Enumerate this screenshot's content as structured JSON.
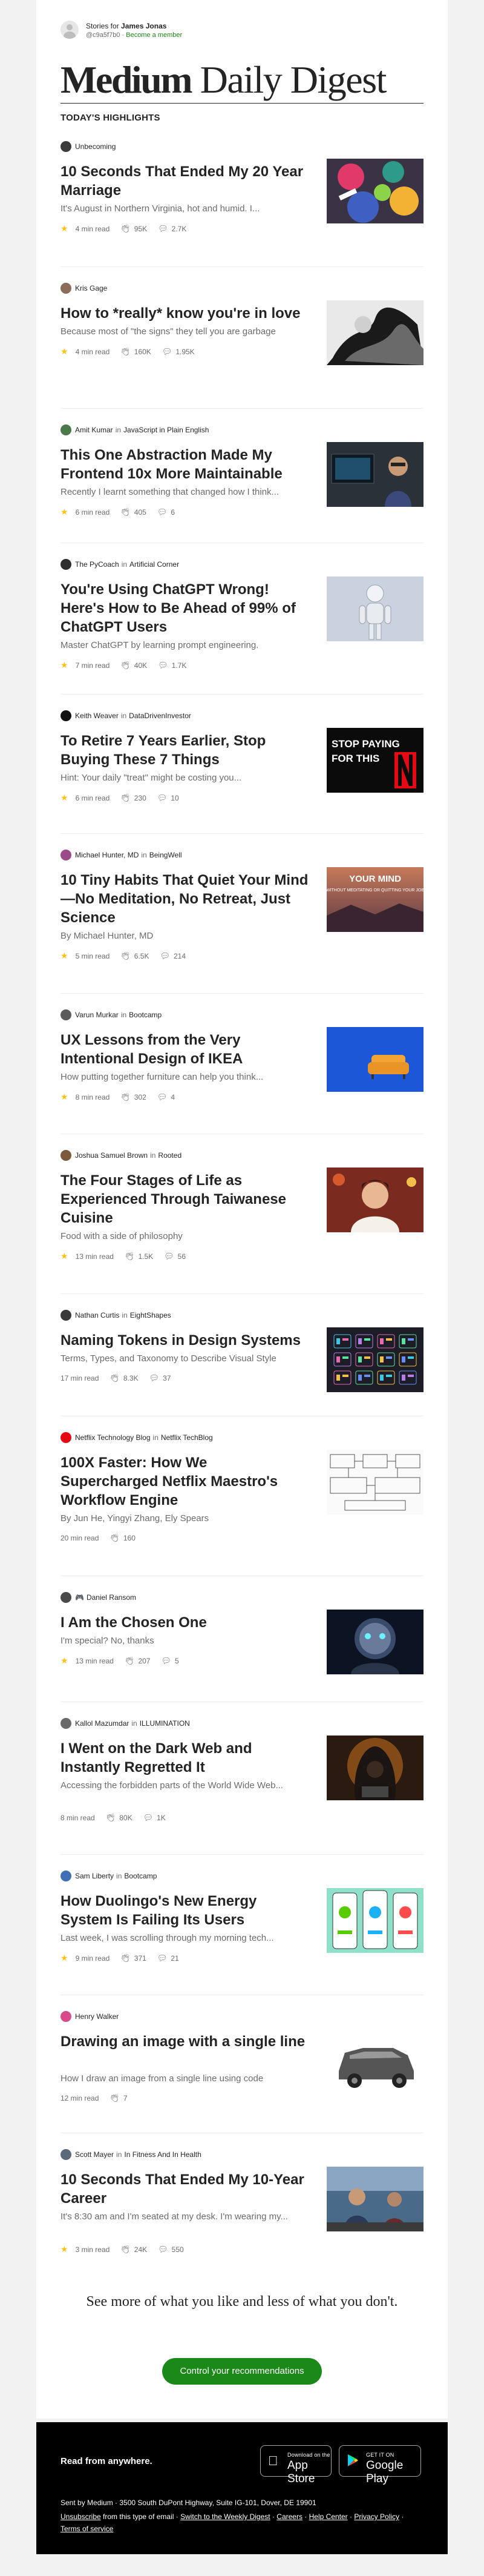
{
  "header": {
    "stories_for_prefix": "Stories for",
    "user_name": "James Jonas",
    "handle": "@c9a5f7b0",
    "separator": "·",
    "become_member": "Become a member"
  },
  "masthead": {
    "brand": "Medium",
    "subtitle": "Daily Digest"
  },
  "section_title": "TODAY'S HIGHLIGHTS",
  "stories": [
    {
      "author": "Unbecoming",
      "in": "",
      "publication": "",
      "title": "10 Seconds That Ended My 20 Year Marriage",
      "subtitle": "It's August in Northern Virginia, hot and humid. I...",
      "member": true,
      "read_time": "4 min read",
      "claps": "95K",
      "responses": "2.7K",
      "icon_color": "#3c3c3c",
      "thumb": "paint"
    },
    {
      "author": "Kris Gage",
      "in": "",
      "publication": "",
      "title": "How to *really* know you're in love",
      "subtitle": "Because most of \"the signs\" they tell you are garbage",
      "member": true,
      "read_time": "4 min read",
      "claps": "160K",
      "responses": "1.95K",
      "icon_color": "#8a6d5a",
      "thumb": "bw"
    },
    {
      "author": "Amit Kumar",
      "in": "in",
      "publication": "JavaScript in Plain English",
      "title": "This One Abstraction Made My Frontend 10x More Maintainable",
      "subtitle": "Recently I learnt something that changed how I think...",
      "member": true,
      "read_time": "6 min read",
      "claps": "405",
      "responses": "6",
      "icon_color": "#4a7a4a",
      "thumb": "laptop"
    },
    {
      "author": "The PyCoach",
      "in": "in",
      "publication": "Artificial Corner",
      "title": "You're Using ChatGPT Wrong! Here's How to Be Ahead of 99% of ChatGPT Users",
      "subtitle": "Master ChatGPT by learning prompt engineering.",
      "member": true,
      "read_time": "7 min read",
      "claps": "40K",
      "responses": "1.7K",
      "icon_color": "#2f2f2f",
      "thumb": "robot"
    },
    {
      "author": "Keith Weaver",
      "in": "in",
      "publication": "DataDrivenInvestor",
      "title": "To Retire 7 Years Earlier, Stop Buying These 7 Things",
      "subtitle": "Hint: Your daily \"treat\" might be costing you...",
      "member": true,
      "read_time": "6 min read",
      "claps": "230",
      "responses": "10",
      "icon_color": "#111111",
      "thumb": "netflix",
      "thumb_text_1": "STOP PAYING",
      "thumb_text_2": "FOR THIS"
    },
    {
      "author": "Michael Hunter, MD",
      "in": "in",
      "publication": "BeingWell",
      "title": "10 Tiny Habits That Quiet Your Mind—No Meditation, No Retreat, Just Science",
      "subtitle": "By Michael Hunter, MD",
      "member": true,
      "read_time": "5 min read",
      "claps": "6.5K",
      "responses": "214",
      "icon_color": "#9b4a8a",
      "thumb": "sunset",
      "thumb_text_1": "YOUR MIND",
      "thumb_text_2": "WITHOUT MEDITATING OR QUITTING YOUR JOB"
    },
    {
      "author": "Varun Murkar",
      "in": "in",
      "publication": "Bootcamp",
      "title": "UX Lessons from the Very Intentional Design of IKEA",
      "subtitle": "How putting together furniture can help you think...",
      "member": true,
      "read_time": "8 min read",
      "claps": "302",
      "responses": "4",
      "icon_color": "#5a5a5a",
      "thumb": "ikea"
    },
    {
      "author": "Joshua Samuel Brown",
      "in": "in",
      "publication": "Rooted",
      "title": "The Four Stages of Life as Experienced Through Taiwanese Cuisine",
      "subtitle": "Food with a side of philosophy",
      "member": true,
      "read_time": "13 min read",
      "claps": "1.5K",
      "responses": "56",
      "icon_color": "#7a5a3a",
      "thumb": "cuisine"
    },
    {
      "author": "Nathan Curtis",
      "in": "in",
      "publication": "EightShapes",
      "title": "Naming Tokens in Design Systems",
      "subtitle": "Terms, Types, and Taxonomy to Describe Visual Style",
      "member": false,
      "read_time": "17 min read",
      "claps": "8.3K",
      "responses": "37",
      "icon_color": "#3a3a3a",
      "thumb": "tokens"
    },
    {
      "author": "Netflix Technology Blog",
      "in": "in",
      "publication": "Netflix TechBlog",
      "title": "100X Faster: How We Supercharged Netflix Maestro's Workflow Engine",
      "subtitle": "By Jun He, Yingyi Zhang, Ely Spears",
      "member": false,
      "read_time": "20 min read",
      "claps": "160",
      "responses": "",
      "icon_color": "#e50914",
      "thumb": "diagram"
    },
    {
      "author": "Daniel Ransom",
      "in": "",
      "publication": "",
      "title": "I Am the Chosen One",
      "subtitle": "I'm special? No, thanks",
      "member": true,
      "read_time": "13 min read",
      "claps": "207",
      "responses": "5",
      "icon_color": "#4a4a4a",
      "thumb": "android",
      "author_badge": "🎮"
    },
    {
      "author": "Kallol Mazumdar",
      "in": "in",
      "publication": "ILLUMINATION",
      "title": "I Went on the Dark Web and Instantly Regretted It",
      "subtitle": "Accessing the forbidden parts of the World Wide Web...",
      "member": false,
      "read_time": "8 min read",
      "claps": "80K",
      "responses": "1K",
      "icon_color": "#6a6a6a",
      "thumb": "hood"
    },
    {
      "author": "Sam Liberty",
      "in": "in",
      "publication": "Bootcamp",
      "title": "How Duolingo's New Energy System Is Failing Its Users",
      "subtitle": "Last week, I was scrolling through my morning tech...",
      "member": true,
      "read_time": "9 min read",
      "claps": "371",
      "responses": "21",
      "icon_color": "#3f6fb5",
      "thumb": "phones"
    },
    {
      "author": "Henry Walker",
      "in": "",
      "publication": "",
      "title": "Drawing an image with a single line",
      "subtitle": "How I draw an image from a single line using code",
      "member": false,
      "read_time": "12 min read",
      "claps": "7",
      "responses": "",
      "icon_color": "#d94a8a",
      "thumb": "car"
    },
    {
      "author": "Scott Mayer",
      "in": "in",
      "publication": "In Fitness And In Health",
      "title": "10 Seconds That Ended My 10-Year Career",
      "subtitle": "It's 8:30 am and I'm seated at my desk. I'm wearing my...",
      "member": true,
      "read_time": "3 min read",
      "claps": "24K",
      "responses": "550",
      "icon_color": "#5a6a7a",
      "thumb": "office"
    }
  ],
  "more": {
    "heading": "See more of what you like and less of what you don't.",
    "button": "Control your recommendations"
  },
  "footer": {
    "read_anywhere": "Read from anywhere.",
    "app_store_small": "Download on the",
    "app_store_big": "App Store",
    "play_small": "GET IT ON",
    "play_big": "Google Play",
    "sent_by": "Sent by Medium · 3500 South DuPont Highway, Suite IG-101, Dover, DE 19901",
    "unsubscribe": "Unsubscribe",
    "unsubscribe_rest": "from this type of email",
    "switch": "Switch to the Weekly Digest",
    "careers": "Careers",
    "help": "Help Center",
    "privacy": "Privacy Policy",
    "terms": "Terms of service",
    "dot": " · "
  },
  "colors": {
    "accent_green": "#1a8917",
    "member_star": "#ffc017",
    "text_primary": "#242424",
    "text_secondary": "#6b6b6b",
    "footer_bg": "#000000"
  },
  "icons": {
    "member": "star-icon",
    "claps": "clap-icon",
    "responses": "response-bubble-icon",
    "apple": "apple-logo-icon",
    "play": "google-play-icon"
  }
}
